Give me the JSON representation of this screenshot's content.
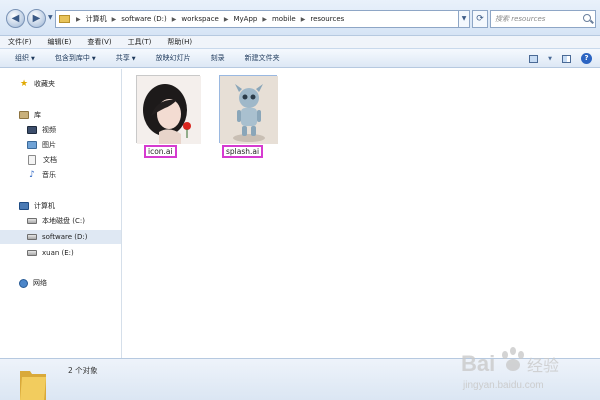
{
  "window": {
    "path": [
      "计算机",
      "software (D:)",
      "workspace",
      "MyApp",
      "mobile",
      "resources"
    ],
    "search": {
      "placeholder": "搜索 resources"
    }
  },
  "menu": [
    "文件(F)",
    "编辑(E)",
    "查看(V)",
    "工具(T)",
    "帮助(H)"
  ],
  "commands": {
    "organize": "组织",
    "include_library": "包含到库中",
    "share": "共享",
    "slideshow": "放映幻灯片",
    "burn": "刻录",
    "new_folder": "新建文件夹"
  },
  "nav": {
    "favorites": "收藏夹",
    "library": "库",
    "videos": "视频",
    "pictures": "图片",
    "documents": "文档",
    "music": "音乐",
    "computer": "计算机",
    "drive_c": "本地磁盘 (C:)",
    "drive_d": "software (D:)",
    "drive_e": "xuan (E:)",
    "network": "网络"
  },
  "files": [
    {
      "name": "icon.ai"
    },
    {
      "name": "splash.ai"
    }
  ],
  "status": {
    "count": "2 个对象"
  },
  "watermark": {
    "brand": "Bai",
    "brand2": "经验",
    "url": "jingyan.baidu.com"
  },
  "colors": {
    "highlight_box": "#d63bd0",
    "selected_row": "#dfe8f3"
  },
  "icons": {
    "back": "arrow-left-icon",
    "forward": "arrow-right-icon",
    "refresh": "refresh-icon",
    "search": "search-icon",
    "help": "help-icon",
    "favorites": "star-icon",
    "folder": "folder-icon"
  }
}
